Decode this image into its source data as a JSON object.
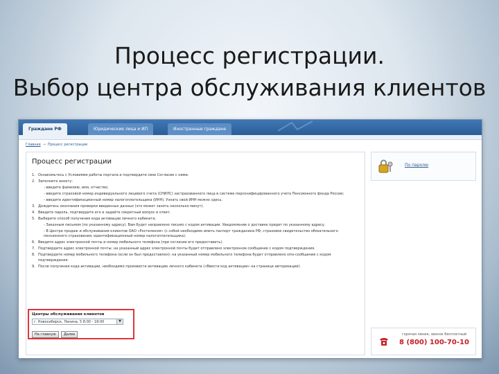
{
  "slide": {
    "title_line1": "Процесс регистрации.",
    "title_line2": "Выбор центра обслуживания клиентов"
  },
  "tabs": [
    {
      "label": "Граждане РФ",
      "active": true
    },
    {
      "label": "Юридические лица и ИП",
      "active": false
    },
    {
      "label": "Иностранные граждане",
      "active": false
    }
  ],
  "breadcrumb": {
    "home": "Главная",
    "separator": "→",
    "current": "Процесс регистрации"
  },
  "main": {
    "heading": "Процесс регистрации",
    "steps": [
      {
        "num": "1.",
        "text": "Ознакомьтесь с Условиями работы портала и подтвердите свое Согласие с ними."
      },
      {
        "num": "2.",
        "text": "Заполните анкету:"
      },
      {
        "num": "",
        "text": "- введите фамилию, имя, отчество;"
      },
      {
        "num": "",
        "text": "- введите страховой номер индивидуального лицевого счета (СНИЛС) застрахованного лица в системе персонифицированного учета Пенсионного фонда России;"
      },
      {
        "num": "",
        "text": "- введите идентификационный номер налогоплательщика (ИНН). Узнать свой ИНН можно здесь."
      },
      {
        "num": "3.",
        "text": "Дождитесь окончания проверки введенных данных (это может занять несколько минут)."
      },
      {
        "num": "4.",
        "text": "Введите пароль, подтвердите его и задайте секретный вопрос и ответ."
      },
      {
        "num": "5.",
        "text": "Выберите способ получения кода активации личного кабинета:"
      },
      {
        "num": "",
        "text": "- Заказным письмом (по указанному адресу). Вам будет направлено письмо с кодом активации. Уведомление о доставке придет по указанному адресу."
      },
      {
        "num": "",
        "text": "- В Центре продаж и обслуживания клиентов ОАО «Ростелеком» (с собой необходимо иметь паспорт гражданина РФ, страховое свидетельство обязательного пенсионного страхования, идентификационный номер налогоплательщика)."
      },
      {
        "num": "6.",
        "text": "Введите адрес электронной почты и номер мобильного телефона (при согласии его предоставить)."
      },
      {
        "num": "7.",
        "text": "Подтвердите адрес электронной почты: на указанный адрес электронной почты будет отправлено электронное сообщение с кодом подтверждения."
      },
      {
        "num": "8.",
        "text": "Подтвердите номер мобильного телефона (если он был предоставлен): на указанный номер мобильного телефона будет отправлено sms-сообщение с кодом подтверждения."
      },
      {
        "num": "9.",
        "text": "После получения кода активации, необходимо произвести активацию личного кабинета («Ввести код активации» на странице авторизации)."
      }
    ],
    "link_here": "здесь",
    "center": {
      "label": "Центры обслуживания клиентов",
      "selected": "г. Новосибирск, Ленина, 5 8:00 - 18:00",
      "back_button": "На главную",
      "next_button": "Далее"
    }
  },
  "side": {
    "login_link": "По паролю"
  },
  "hotline": {
    "label": "горячая линия, звонок бесплатный",
    "number": "8 (800) 100-70-10"
  },
  "colors": {
    "tab_bar": "#2c5e98",
    "highlight_border": "#e0343a",
    "hotline_number": "#c32026"
  }
}
